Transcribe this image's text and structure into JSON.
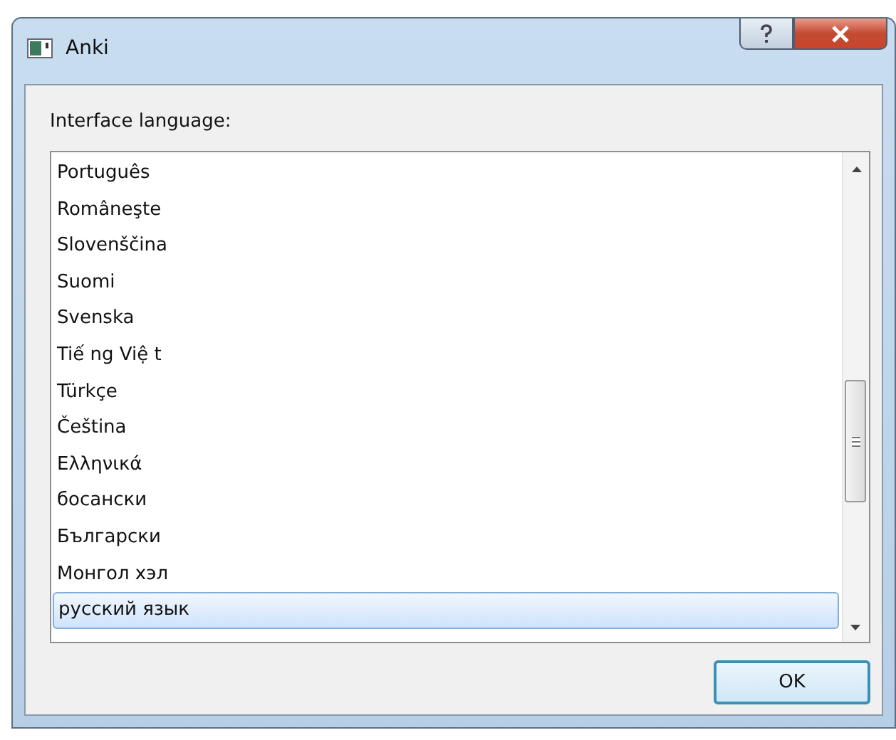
{
  "window": {
    "title": "Anki"
  },
  "label": "Interface language:",
  "languages": [
    {
      "name": "Português",
      "selected": false
    },
    {
      "name": "Româneşte",
      "selected": false
    },
    {
      "name": "Slovenščina",
      "selected": false
    },
    {
      "name": "Suomi",
      "selected": false
    },
    {
      "name": "Svenska",
      "selected": false
    },
    {
      "name": "Tiế ng Việ t",
      "selected": false
    },
    {
      "name": "Türkçe",
      "selected": false
    },
    {
      "name": "Čeština",
      "selected": false
    },
    {
      "name": "Ελληνικά",
      "selected": false
    },
    {
      "name": "босански",
      "selected": false
    },
    {
      "name": "Български",
      "selected": false
    },
    {
      "name": "Монгол хэл",
      "selected": false
    },
    {
      "name": "русский язык",
      "selected": true
    }
  ],
  "buttons": [
    "OK"
  ]
}
